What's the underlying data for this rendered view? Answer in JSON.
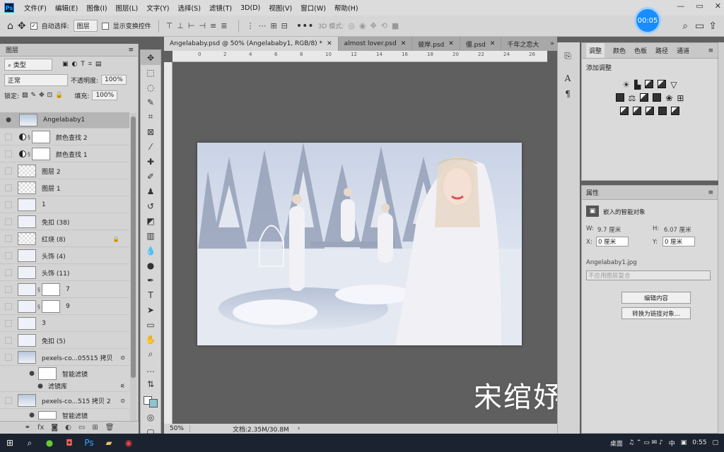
{
  "menubar": {
    "logo": "Ps",
    "items": [
      "文件(F)",
      "编辑(E)",
      "图像(I)",
      "图层(L)",
      "文字(Y)",
      "选择(S)",
      "滤镜(T)",
      "3D(D)",
      "视图(V)",
      "窗口(W)",
      "帮助(H)"
    ],
    "window_controls": [
      "—",
      "▭",
      "✕"
    ]
  },
  "options_bar": {
    "auto_select_label": "自动选择:",
    "auto_select_value": "图层",
    "show_transform_label": "显示变换控件",
    "mode_3d_label": "3D 模式:",
    "timer": "00:05"
  },
  "layers_panel": {
    "tab": "图层",
    "filter_type": "类型",
    "blend_mode": "正常",
    "opacity_label": "不透明度:",
    "opacity_value": "100%",
    "lock_label": "锁定:",
    "fill_label": "填充:",
    "fill_value": "100%",
    "layers": [
      {
        "name": "Angelababy1"
      },
      {
        "name": "颜色查找 2"
      },
      {
        "name": "颜色查找 1"
      },
      {
        "name": "图层 2"
      },
      {
        "name": "图层 1"
      },
      {
        "name": "1"
      },
      {
        "name": "免扣 (38)"
      },
      {
        "name": "红烧 (8)"
      },
      {
        "name": "头饰 (4)"
      },
      {
        "name": "头饰 (11)"
      },
      {
        "name": "7"
      },
      {
        "name": "9"
      },
      {
        "name": "3"
      },
      {
        "name": "免扣 (5)"
      },
      {
        "name": "pexels-co...05515 拷贝"
      },
      {
        "name": "智能滤镜"
      },
      {
        "name": "滤镜库"
      },
      {
        "name": "pexels-co...515 拷贝 2"
      },
      {
        "name": "智能滤镜"
      }
    ]
  },
  "document_tabs": [
    {
      "label": "Angelababy.psd @ 50% (Angelababy1, RGB/8) *"
    },
    {
      "label": "almost lover.psd"
    },
    {
      "label": "彼岸.psd"
    },
    {
      "label": "僵.psd"
    },
    {
      "label": "千年之恋大"
    }
  ],
  "tabs_overflow": "»",
  "ruler_ticks": [
    "0",
    "2",
    "4",
    "6",
    "8",
    "10",
    "12",
    "14",
    "16",
    "18",
    "20",
    "22",
    "24",
    "26"
  ],
  "canvas_caption": "宋绾妤",
  "status": {
    "zoom": "50%",
    "doc_info": "文档:2.35M/30.8M"
  },
  "adjustments_panel": {
    "tabs": [
      "调整",
      "颜色",
      "色板",
      "路径",
      "通道"
    ],
    "title": "添加调整"
  },
  "properties_panel": {
    "tab": "属性",
    "type": "嵌入的智能对象",
    "w_label": "W:",
    "w_value": "9.7 厘米",
    "h_label": "H:",
    "h_value": "6.07 厘米",
    "x_label": "X:",
    "x_value": "0 厘米",
    "y_label": "Y:",
    "y_value": "0 厘米",
    "filename": "Angelababy1.jpg",
    "comp_select": "不应用图层复合",
    "edit_button": "编辑内容",
    "convert_button": "转换为链接对象..."
  },
  "taskbar": {
    "desktop": "桌面",
    "ime": "中",
    "time": "0:55"
  }
}
